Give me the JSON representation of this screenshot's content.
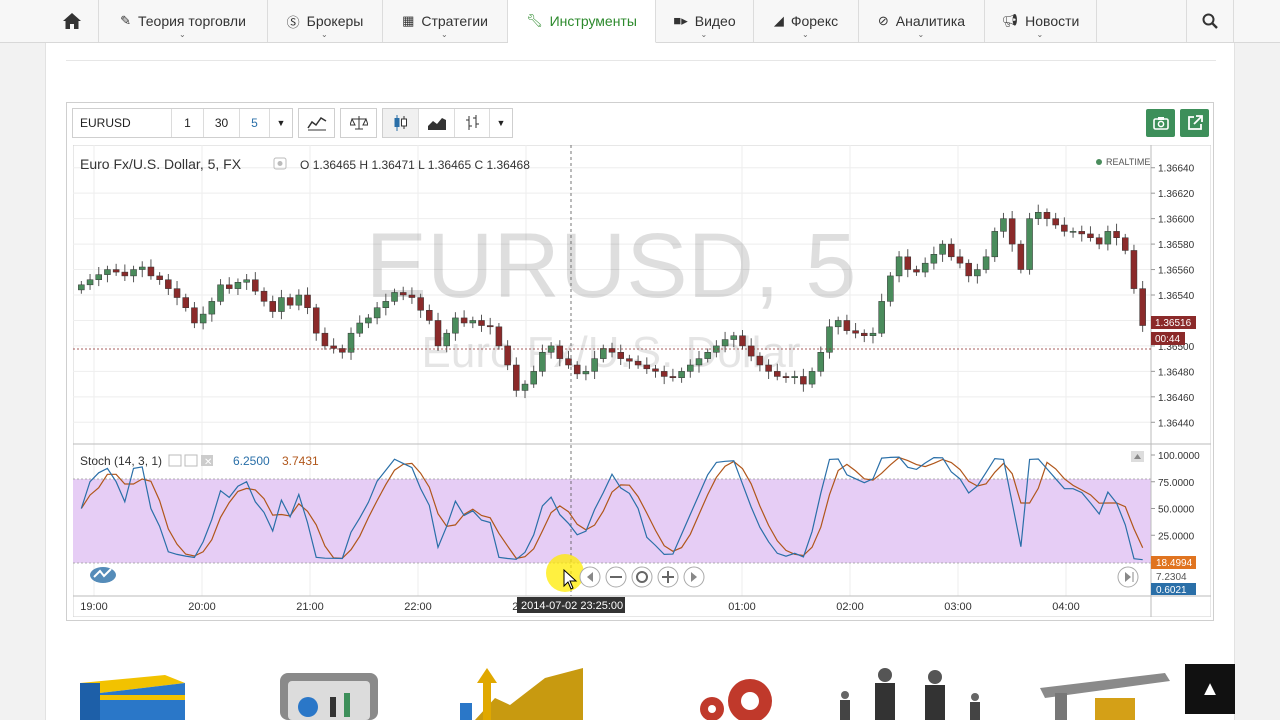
{
  "nav": {
    "home_icon": "home-icon",
    "items": [
      {
        "label": "Теория торговли",
        "icon": "pencil-icon"
      },
      {
        "label": "Брокеры",
        "icon": "dollar-icon"
      },
      {
        "label": "Стратегии",
        "icon": "grid-icon"
      },
      {
        "label": "Инструменты",
        "icon": "wrench-icon",
        "active": true
      },
      {
        "label": "Видео",
        "icon": "video-icon"
      },
      {
        "label": "Форекс",
        "icon": "chart-icon"
      },
      {
        "label": "Аналитика",
        "icon": "circle-icon"
      },
      {
        "label": "Новости",
        "icon": "megaphone-icon"
      }
    ],
    "search_icon": "search-icon"
  },
  "toolbar": {
    "symbol": "EURUSD",
    "intervals": [
      "1",
      "30",
      "5"
    ],
    "active_interval": "5"
  },
  "chart": {
    "title": "Euro Fx/U.S. Dollar, 5, FX",
    "ohlc": {
      "o_label": "O",
      "o": "1.36465",
      "h_label": "H",
      "h": "1.36471",
      "l_label": "L",
      "l": "1.36465",
      "c_label": "C",
      "c": "1.36468"
    },
    "realtime": "REALTIME",
    "watermark_symbol": "EURUSD, 5",
    "watermark_name": "Euro Fx/U.S. Dollar",
    "price_ticks": [
      "1.36640",
      "1.36620",
      "1.36600",
      "1.36580",
      "1.36560",
      "1.36540",
      "1.36520",
      "1.36500",
      "1.36480",
      "1.36460",
      "1.36440"
    ],
    "current_price": "1.36516",
    "countdown": "00:44",
    "time_ticks": [
      "19:00",
      "20:00",
      "21:00",
      "22:00",
      "23:00",
      "01:00",
      "02:00",
      "03:00",
      "04:00"
    ],
    "crosshair_time": "2014-07-02 23:25:00",
    "colors": {
      "up": "#4a8c5c",
      "down": "#8b2a2a",
      "stoch_k": "#2a6fa8",
      "stoch_d": "#b0561a",
      "band": "#e6cdf5"
    }
  },
  "stoch": {
    "label": "Stoch (14, 3, 1)",
    "k_value": "6.2500",
    "d_value": "3.7431",
    "ticks": [
      "100.0000",
      "75.0000",
      "50.0000",
      "25.0000"
    ],
    "current_d": "18.4994",
    "current_k2": "7.2304",
    "current_k": "0.6021"
  },
  "chart_data": {
    "type": "candlestick",
    "title": "Euro Fx/U.S. Dollar, 5, FX",
    "y_range": [
      1.3643,
      1.3665
    ],
    "x_range": [
      "18:45",
      "04:50"
    ],
    "candles_close": [
      1.36548,
      1.36552,
      1.36556,
      1.3656,
      1.36558,
      1.36555,
      1.3656,
      1.36562,
      1.36555,
      1.36552,
      1.36545,
      1.36538,
      1.3653,
      1.36518,
      1.36525,
      1.36535,
      1.36548,
      1.36545,
      1.3655,
      1.36552,
      1.36543,
      1.36535,
      1.36527,
      1.36538,
      1.36532,
      1.3654,
      1.3653,
      1.3651,
      1.365,
      1.36498,
      1.36495,
      1.3651,
      1.36518,
      1.36522,
      1.3653,
      1.36535,
      1.36542,
      1.3654,
      1.36538,
      1.36528,
      1.3652,
      1.365,
      1.3651,
      1.36522,
      1.36518,
      1.3652,
      1.36516,
      1.36515,
      1.365,
      1.36485,
      1.36465,
      1.3647,
      1.3648,
      1.36495,
      1.365,
      1.3649,
      1.36485,
      1.36478,
      1.3648,
      1.3649,
      1.36498,
      1.36495,
      1.3649,
      1.36488,
      1.36485,
      1.36482,
      1.3648,
      1.36476,
      1.36475,
      1.3648,
      1.36485,
      1.3649,
      1.36495,
      1.365,
      1.36505,
      1.36508,
      1.365,
      1.36492,
      1.36485,
      1.3648,
      1.36476,
      1.36475,
      1.36476,
      1.3647,
      1.3648,
      1.36495,
      1.36515,
      1.3652,
      1.36512,
      1.3651,
      1.36508,
      1.3651,
      1.36535,
      1.36555,
      1.3657,
      1.3656,
      1.36558,
      1.36565,
      1.36572,
      1.3658,
      1.3657,
      1.36565,
      1.36555,
      1.3656,
      1.3657,
      1.3659,
      1.366,
      1.3658,
      1.3656,
      1.366,
      1.36605,
      1.366,
      1.36595,
      1.3659,
      1.3659,
      1.36588,
      1.36585,
      1.3658,
      1.3659,
      1.36585,
      1.36575,
      1.36545,
      1.36516
    ]
  }
}
